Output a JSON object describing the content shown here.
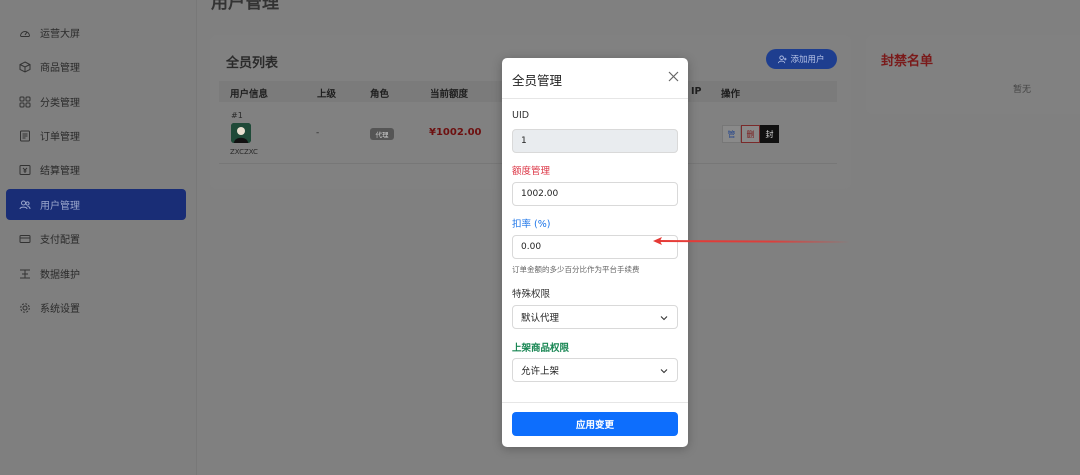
{
  "page": {
    "title": "用户管理"
  },
  "sidebar": {
    "items": [
      {
        "label": "运营大屏",
        "icon": "dashboard-icon"
      },
      {
        "label": "商品管理",
        "icon": "box-icon"
      },
      {
        "label": "分类管理",
        "icon": "grid-icon"
      },
      {
        "label": "订单管理",
        "icon": "receipt-icon"
      },
      {
        "label": "结算管理",
        "icon": "settlement-icon"
      },
      {
        "label": "用户管理",
        "icon": "users-icon",
        "active": true
      },
      {
        "label": "支付配置",
        "icon": "card-icon"
      },
      {
        "label": "数据维护",
        "icon": "database-icon"
      },
      {
        "label": "系统设置",
        "icon": "gear-icon"
      }
    ]
  },
  "member_list": {
    "title": "全员列表",
    "add_user_label": "添加用户",
    "columns": [
      "用户信息",
      "上级",
      "角色",
      "当前额度",
      "IP",
      "操作"
    ],
    "rows": [
      {
        "uid": "#1",
        "name": "ZXCZXC",
        "parent": "-",
        "role": "代理",
        "amount": "¥1002.00",
        "ops": [
          "管",
          "删",
          "封"
        ]
      }
    ]
  },
  "ban_list": {
    "title": "封禁名单",
    "empty_text": "暂无"
  },
  "modal": {
    "title": "全员管理",
    "uid_label": "UID",
    "uid_value": "1",
    "quota_label": "额度管理",
    "quota_value": "1002.00",
    "rate_label": "扣率 (%)",
    "rate_value": "0.00",
    "rate_help": "订单金额的多少百分比作为平台手续费",
    "permission_label": "特殊权限",
    "permission_value": "默认代理",
    "listing_label": "上架商品权限",
    "listing_value": "允许上架",
    "apply_label": "应用变更"
  },
  "colors": {
    "accent": "#0d6efd",
    "danger": "#dc3545",
    "success": "#198754",
    "annotation_arrow": "#e53935"
  }
}
